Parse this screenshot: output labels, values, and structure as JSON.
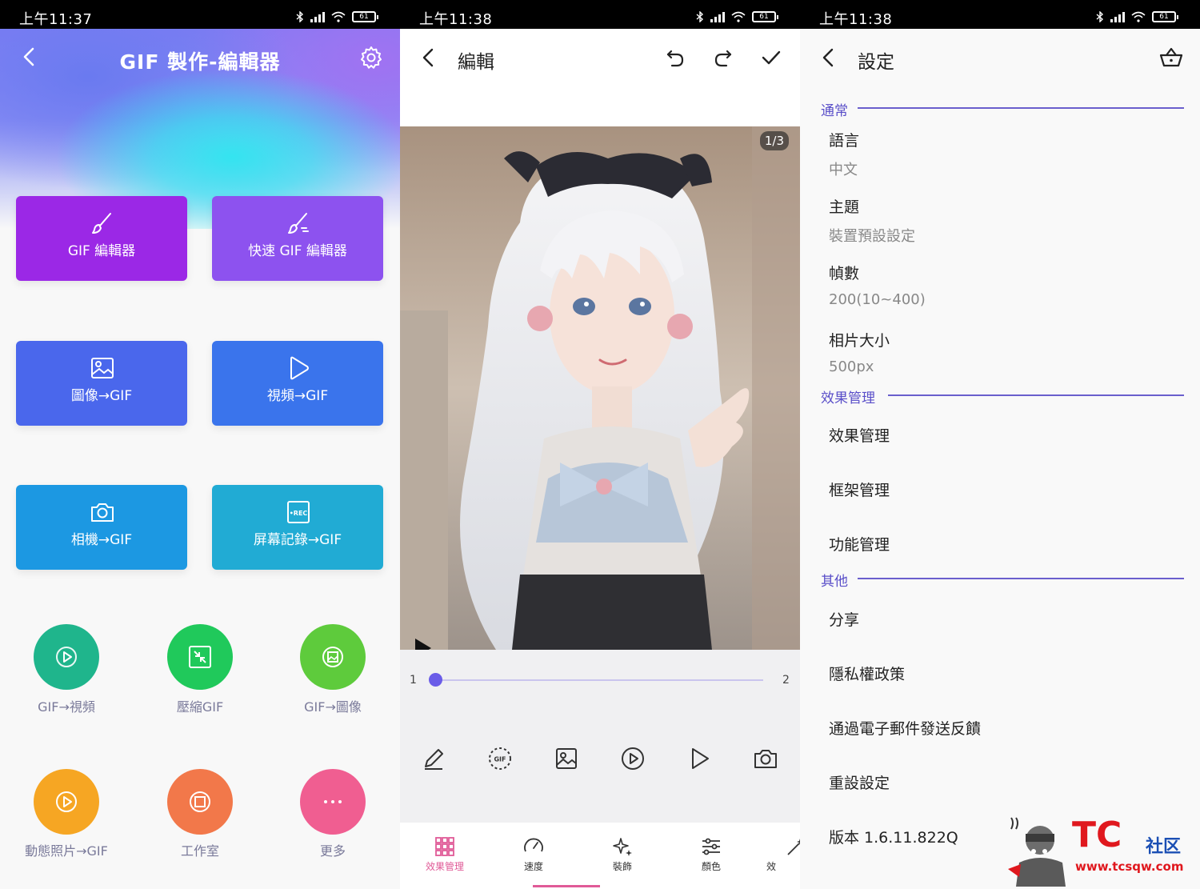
{
  "panel1": {
    "status_time": "上午11:37",
    "battery": "61",
    "title": "GIF 製作-編輯器",
    "tiles": [
      {
        "label": "GIF 編輯器"
      },
      {
        "label": "快速 GIF 編輯器"
      },
      {
        "label": "圖像→GIF"
      },
      {
        "label": "視頻→GIF"
      },
      {
        "label": "相機→GIF"
      },
      {
        "label": "屏幕記錄→GIF"
      }
    ],
    "circles": [
      {
        "label": "GIF→視頻",
        "color": "#1fb58c"
      },
      {
        "label": "壓縮GIF",
        "color": "#20c95b"
      },
      {
        "label": "GIF→圖像",
        "color": "#5ecb3c"
      },
      {
        "label": "動態照片→GIF",
        "color": "#f6a623"
      },
      {
        "label": "工作室",
        "color": "#f2784a"
      },
      {
        "label": "更多",
        "color": "#f05e91"
      }
    ]
  },
  "panel2": {
    "status_time": "上午11:38",
    "battery": "61",
    "title": "編輯",
    "page_indicator": "1/3",
    "frame_start": "1",
    "frame_end": "2",
    "slider_position": 0.0,
    "nav": [
      {
        "label": "效果管理"
      },
      {
        "label": "速度"
      },
      {
        "label": "裝飾"
      },
      {
        "label": "顏色"
      },
      {
        "label": "效"
      }
    ],
    "accent": "#e05a97"
  },
  "panel3": {
    "status_time": "上午11:38",
    "battery": "61",
    "title": "設定",
    "sections": {
      "general": "通常",
      "effects": "效果管理",
      "other": "其他"
    },
    "items": {
      "language": "語言",
      "language_value": "中文",
      "theme": "主題",
      "theme_value": "裝置預設設定",
      "frames": "幀數",
      "frames_value": "200(10~400)",
      "photo_size": "相片大小",
      "photo_size_value": "500px",
      "effect_manage": "效果管理",
      "frame_manage": "框架管理",
      "feature_manage": "功能管理",
      "share": "分享",
      "privacy": "隱私權政策",
      "feedback": "通過電子郵件發送反饋",
      "reset": "重設設定",
      "version": "版本 1.6.11.822Q"
    },
    "accent": "#5a4fc9"
  },
  "watermark": {
    "logo": "TC",
    "cn": "社区",
    "url": "www.tcsqw.com"
  }
}
